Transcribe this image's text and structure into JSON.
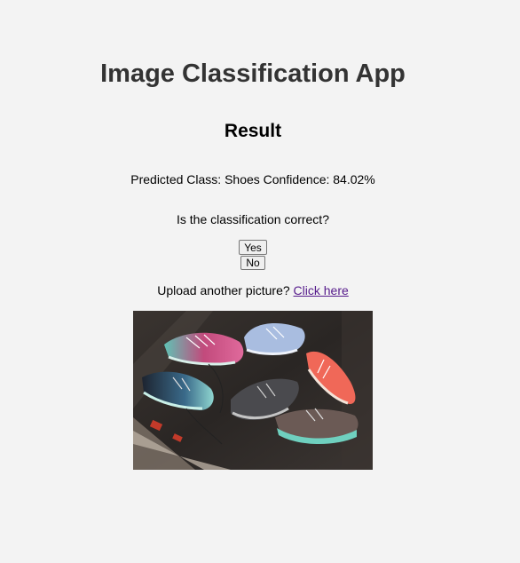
{
  "header": {
    "title": "Image Classification App"
  },
  "result": {
    "heading": "Result",
    "prediction_text": "Predicted Class: Shoes Confidence: 84.02%"
  },
  "feedback": {
    "question": "Is the classification correct?",
    "yes_label": "Yes",
    "no_label": "No"
  },
  "upload": {
    "prompt": "Upload another picture?",
    "link_label": "Click here"
  },
  "image": {
    "icon": "uploaded-shoes-photo"
  },
  "colors": {
    "background": "#f3f3f3",
    "title": "#333333",
    "link": "#551a8b"
  }
}
